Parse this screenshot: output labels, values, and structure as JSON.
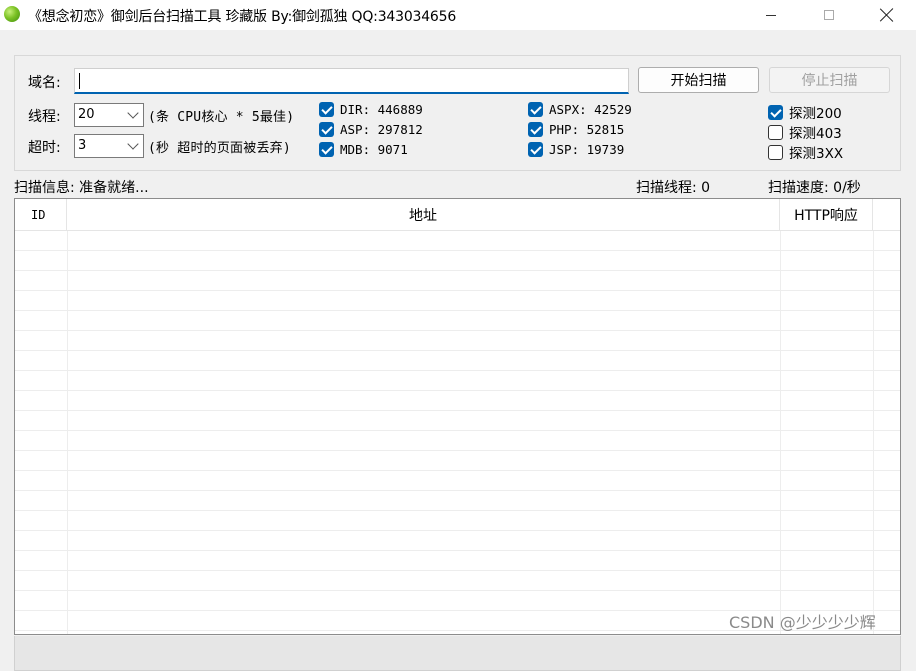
{
  "window": {
    "title": "《想念初恋》御剑后台扫描工具 珍藏版 By:御剑孤独 QQ:343034656"
  },
  "form": {
    "domain_label": "域名:",
    "domain_value": "",
    "start_button": "开始扫描",
    "stop_button": "停止扫描",
    "threads_label": "线程:",
    "threads_value": "20",
    "threads_hint": "(条 CPU核心 * 5最佳)",
    "timeout_label": "超时:",
    "timeout_value": "3",
    "timeout_hint": "(秒 超时的页面被丢弃)"
  },
  "dicts": [
    {
      "label": "DIR: 446889",
      "checked": true
    },
    {
      "label": "ASP: 297812",
      "checked": true
    },
    {
      "label": "MDB: 9071",
      "checked": true
    },
    {
      "label": "ASPX: 42529",
      "checked": true
    },
    {
      "label": "PHP: 52815",
      "checked": true
    },
    {
      "label": "JSP: 19739",
      "checked": true
    }
  ],
  "probes": [
    {
      "label": "探测200",
      "checked": true
    },
    {
      "label": "探测403",
      "checked": false
    },
    {
      "label": "探测3XX",
      "checked": false
    }
  ],
  "status": {
    "info": "扫描信息: 准备就绪...",
    "threads": "扫描线程: 0",
    "speed": "扫描速度: 0/秒"
  },
  "table": {
    "columns": [
      "ID",
      "地址",
      "HTTP响应"
    ],
    "rows": []
  },
  "watermark": "CSDN @少少少少辉",
  "colors": {
    "accent": "#0063b1",
    "client_bg": "#f0f0f0"
  },
  "icons": {
    "app": "green-ball-icon",
    "minimize": "minimize-icon",
    "maximize": "maximize-icon",
    "close": "close-icon"
  }
}
